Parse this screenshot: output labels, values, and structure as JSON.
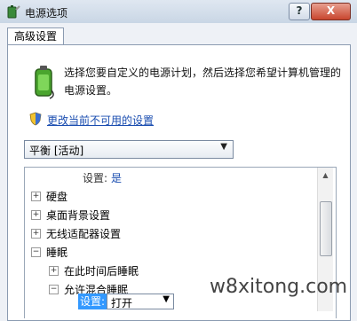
{
  "window": {
    "title": "电源选项",
    "help_label": "?",
    "close_label": "X"
  },
  "tab": {
    "label": "高级设置"
  },
  "intro": {
    "description": "选择您要自定义的电源计划，然后选择您希望计算机管理的电源设置。"
  },
  "change_link": "更改当前不可用的设置",
  "plan_select": {
    "value": "平衡 [活动]",
    "arrow": "▼"
  },
  "tree": {
    "top_setting_label": "设置:",
    "top_setting_value": "是",
    "items": [
      {
        "label": "硬盘",
        "expander": "+"
      },
      {
        "label": "桌面背景设置",
        "expander": "+"
      },
      {
        "label": "无线适配器设置",
        "expander": "+"
      },
      {
        "label": "睡眠",
        "expander": "−"
      }
    ],
    "sub_items": [
      {
        "label": "在此时间后睡眠",
        "expander": "+"
      },
      {
        "label": "允许混合睡眠",
        "expander": "−"
      }
    ],
    "hybrid_setting_label": "设置:",
    "hybrid_setting_value": "打开",
    "hybrid_arrow": "▼"
  },
  "scrollbar": {
    "up_arrow": "▲"
  },
  "watermark": "w8xitong.com",
  "colors": {
    "link": "#1a4db0",
    "selection": "#3399ff",
    "close_button": "#c8462e"
  }
}
